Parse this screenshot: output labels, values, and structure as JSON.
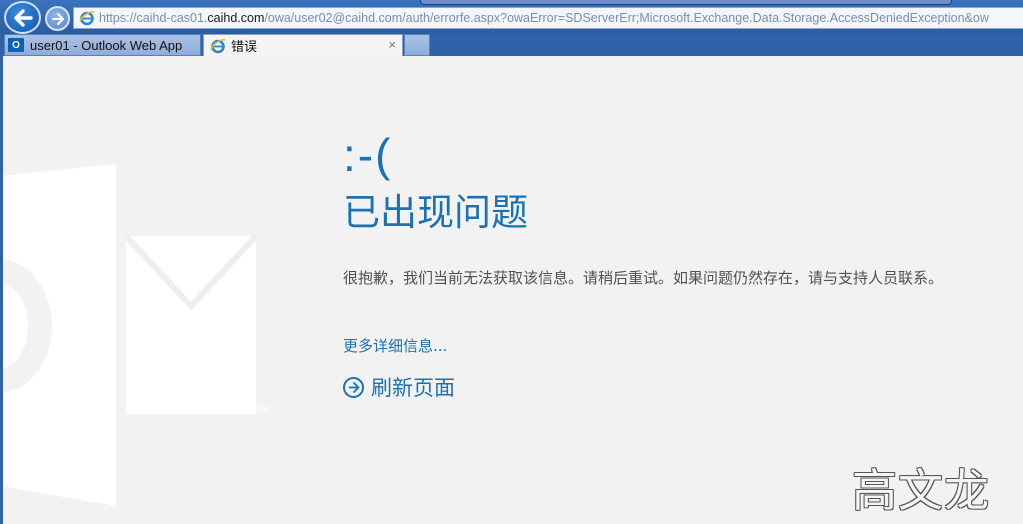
{
  "browser": {
    "address_url_host_prefix": "https://caihd-cas01.",
    "address_url_host_domain": "caihd.com",
    "address_url_path": "/owa/user02@caihd.com/auth/errorfe.aspx?owaError=SDServerErr;Microsoft.Exchange.Data.Storage.AccessDeniedException&ow",
    "tabs": [
      {
        "label": "user01 - Outlook Web App",
        "icon": "outlook-icon",
        "active": false
      },
      {
        "label": "错误",
        "icon": "ie-icon",
        "active": true
      }
    ],
    "close_glyph": "×"
  },
  "error_page": {
    "emoticon": ":-(",
    "heading": "已出现问题",
    "message": "很抱歉，我们当前无法获取该信息。请稍后重试。如果问题仍然存在，请与支持人员联系。",
    "more_info_link": "更多详细信息...",
    "refresh_label": "刷新页面"
  },
  "signature": "高文龙",
  "colors": {
    "accent": "#1a72b6",
    "chrome": "#2f62a8",
    "background": "#f2f2f2",
    "body_text": "#505050"
  }
}
